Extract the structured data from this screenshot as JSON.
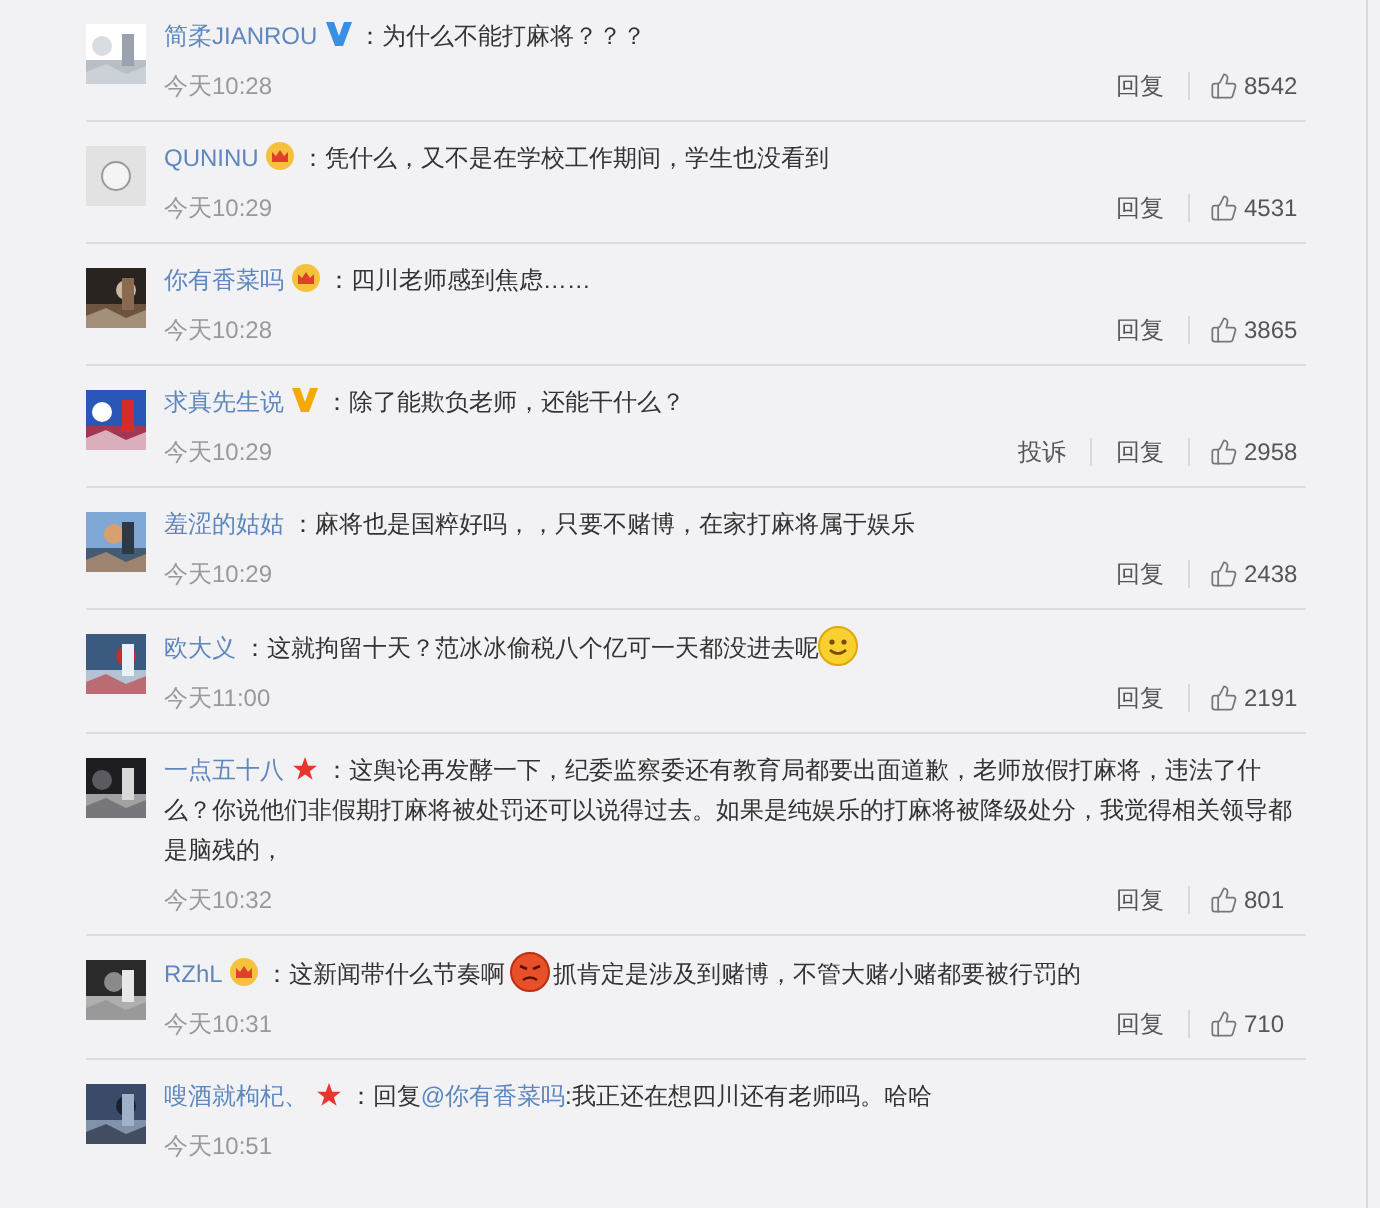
{
  "comments": [
    {
      "avatar": {
        "kind": "picture"
      },
      "name": "简柔JIANROU",
      "badge": {
        "kind": "vblue"
      },
      "parts": [
        {
          "kind": "text",
          "text": "：为什么不能打麻将？？？"
        }
      ],
      "time": "今天10:28",
      "actions": [
        "回复"
      ],
      "likes": "8542"
    },
    {
      "avatar": {
        "kind": "default"
      },
      "name": "QUNINU",
      "badge": {
        "kind": "crown"
      },
      "parts": [
        {
          "kind": "text",
          "text": "：凭什么，又不是在学校工作期间，学生也没看到"
        }
      ],
      "time": "今天10:29",
      "actions": [
        "回复"
      ],
      "likes": "4531"
    },
    {
      "avatar": {
        "kind": "picture"
      },
      "name": "你有香菜吗",
      "badge": {
        "kind": "crown"
      },
      "parts": [
        {
          "kind": "text",
          "text": "：四川老师感到焦虑……"
        }
      ],
      "time": "今天10:28",
      "actions": [
        "回复"
      ],
      "likes": "3865"
    },
    {
      "avatar": {
        "kind": "picture"
      },
      "name": "求真先生说",
      "badge": {
        "kind": "vgold"
      },
      "parts": [
        {
          "kind": "text",
          "text": "：除了能欺负老师，还能干什么？"
        }
      ],
      "time": "今天10:29",
      "actions": [
        "投诉",
        "回复"
      ],
      "likes": "2958"
    },
    {
      "avatar": {
        "kind": "picture"
      },
      "name": "羞涩的姑姑",
      "parts": [
        {
          "kind": "text",
          "text": "：麻将也是国粹好吗，，只要不赌博，在家打麻将属于娱乐"
        }
      ],
      "time": "今天10:29",
      "actions": [
        "回复"
      ],
      "likes": "2438"
    },
    {
      "avatar": {
        "kind": "picture"
      },
      "name": "欧大义",
      "parts": [
        {
          "kind": "text",
          "text": "：这就拘留十天？范冰冰偷税八个亿可一天都没进去呢"
        },
        {
          "kind": "smiley"
        }
      ],
      "time": "今天11:00",
      "actions": [
        "回复"
      ],
      "likes": "2191"
    },
    {
      "avatar": {
        "kind": "picture"
      },
      "name": "一点五十八",
      "badge": {
        "kind": "star"
      },
      "parts": [
        {
          "kind": "text",
          "text": "：这舆论再发酵一下，纪委监察委还有教育局都要出面道歉，老师放假打麻将，违法了什么？你说他们非假期打麻将被处罚还可以说得过去。如果是纯娱乐的打麻将被降级处分，我觉得相关领导都是脑残的，"
        }
      ],
      "time": "今天10:32",
      "actions": [
        "回复"
      ],
      "likes": "801"
    },
    {
      "avatar": {
        "kind": "picture"
      },
      "name": "RZhL",
      "badge": {
        "kind": "crown"
      },
      "parts": [
        {
          "kind": "text",
          "text": "：这新闻带什么节奏啊"
        },
        {
          "kind": "angry"
        },
        {
          "kind": "text",
          "text": "抓肯定是涉及到赌博，不管大赌小赌都要被行罚的"
        }
      ],
      "time": "今天10:31",
      "actions": [
        "回复"
      ],
      "likes": "710"
    },
    {
      "avatar": {
        "kind": "picture"
      },
      "name": "嗖酒就枸杞、",
      "badge": {
        "kind": "star"
      },
      "parts": [
        {
          "kind": "text",
          "text": "：回复"
        },
        {
          "kind": "link",
          "text": "@你有香菜吗"
        },
        {
          "kind": "text",
          "text": ":我正还在想四川还有老师吗。哈哈"
        }
      ],
      "time": "今天10:51"
    }
  ]
}
